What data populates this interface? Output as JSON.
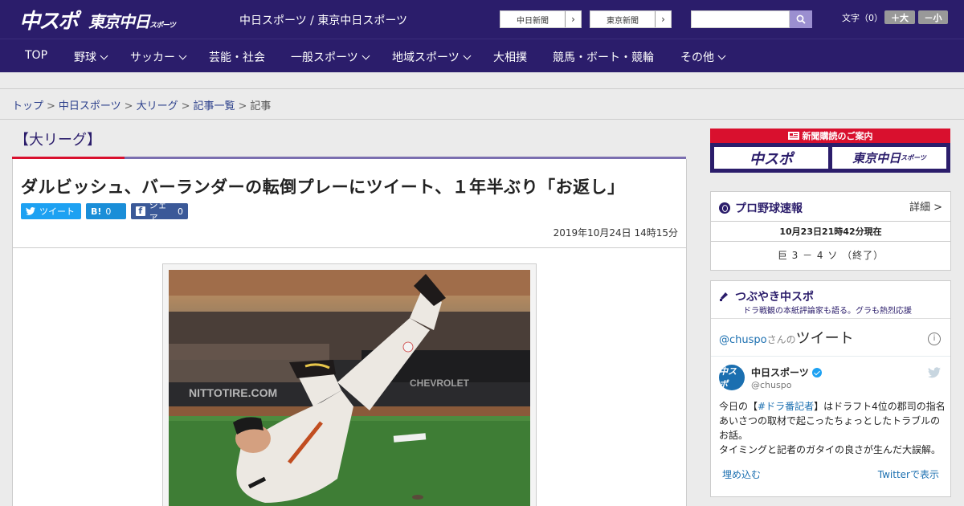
{
  "header": {
    "logo_chuspo": "中スポ",
    "logo_tokyo": "東京中日",
    "logo_tokyo_small": "スポーツ",
    "site_title": "中日スポーツ / 東京中日スポーツ",
    "ext_links": [
      {
        "label": "中日新聞"
      },
      {
        "label": "東京新聞"
      }
    ],
    "search_placeholder": "",
    "font_size_label": "文字（0）",
    "font_larger": "＋大",
    "font_smaller": "－小"
  },
  "nav": [
    {
      "label": "TOP",
      "dropdown": false
    },
    {
      "label": "野球",
      "dropdown": true
    },
    {
      "label": "サッカー",
      "dropdown": true
    },
    {
      "label": "芸能・社会",
      "dropdown": false
    },
    {
      "label": "一般スポーツ",
      "dropdown": true
    },
    {
      "label": "地域スポーツ",
      "dropdown": true
    },
    {
      "label": "大相撲",
      "dropdown": false
    },
    {
      "label": "競馬・ボート・競輪",
      "dropdown": false
    },
    {
      "label": "その他",
      "dropdown": true
    }
  ],
  "breadcrumb": {
    "items": [
      "トップ",
      "中日スポーツ",
      "大リーグ",
      "記事一覧"
    ],
    "current": "記事",
    "separator": ">"
  },
  "article": {
    "category": "【大リーグ】",
    "headline": "ダルビッシュ、バーランダーの転倒プレーにツイート、１年半ぶり「お返し」",
    "share": {
      "twitter_label": "ツイート",
      "hatena_icon": "B!",
      "hatena_count": "0",
      "facebook_label": "シェア",
      "facebook_count": "0"
    },
    "date": "2019年10月24日 14時15分"
  },
  "sidebar": {
    "subscription": {
      "heading": "新聞購読のご案内",
      "chuspo": "中スポ",
      "tokyo": "東京中日",
      "tokyo_small": "スポーツ"
    },
    "scores": {
      "title": "プロ野球速報",
      "detail": "詳細 >",
      "time": "10月23日21時42分現在",
      "line": "巨 3 － 4 ソ （終了）"
    },
    "tweets": {
      "title": "つぶやき中スポ",
      "subtitle": "ドラ戦観の本紙評論家も語る。グラも熱烈応援",
      "widget_handle": "@chuspo",
      "widget_san": "さんの",
      "widget_heading": "ツイート",
      "account_name": "中日スポーツ",
      "account_handle": "@chuspo",
      "avatar_text": "中スポ",
      "tweet_prefix": "今日の【",
      "tweet_tag": "#ドラ番記者",
      "tweet_rest": "】はドラフト4位の郡司の指名あいさつの取材で起こったちょっとしたトラブルのお話。",
      "tweet_line2": "タイミングと記者のガタイの良さが生んだ大誤解。",
      "embed": "埋め込む",
      "view_on_twitter": "Twitterで表示"
    }
  },
  "colors": {
    "brand_navy": "#2b1d6b",
    "accent_red": "#d9102e",
    "twitter_blue": "#1da1f2",
    "facebook_blue": "#3b5998"
  }
}
